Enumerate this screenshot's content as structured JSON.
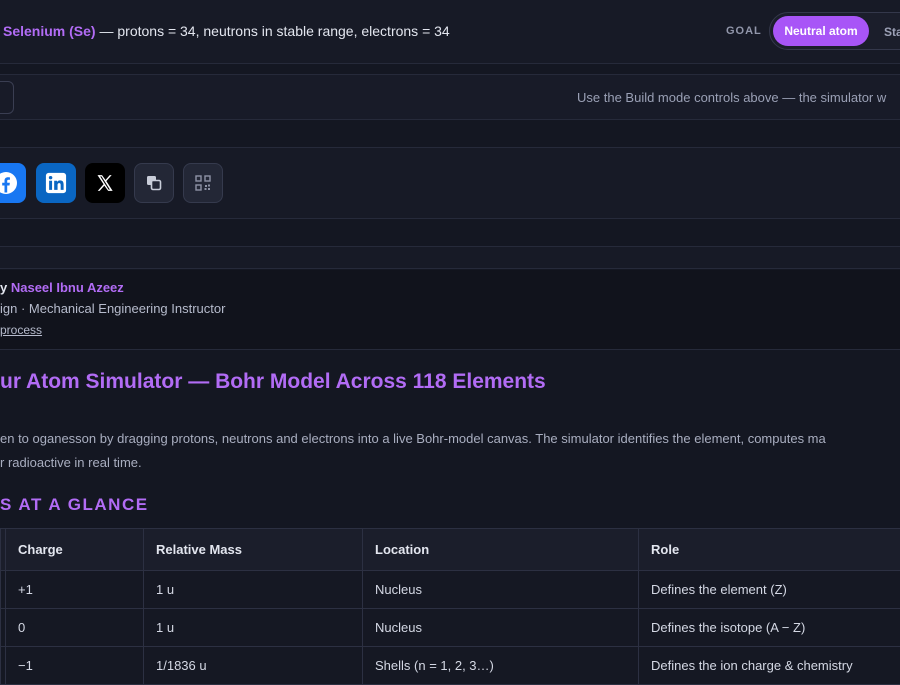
{
  "goal_bar": {
    "element": "Selenium (Se)",
    "description": " — protons = 34, neutrons in stable range, electrons = 34",
    "goal_label": "GOAL",
    "toggle_active": "Neutral atom",
    "toggle_next": "Sta"
  },
  "hint": {
    "text": "Use the Build mode controls above — the simulator w"
  },
  "share": {
    "facebook_icon": "facebook-icon",
    "linkedin_icon": "linkedin-icon",
    "x_icon": "x-icon",
    "copy_icon": "copy-icon",
    "qr_icon": "qr-code-icon"
  },
  "author": {
    "prefix": "y ",
    "name": "Naseel Ibnu Azeez",
    "role": "ign · Mechanical Engineering Instructor",
    "link": "process"
  },
  "article": {
    "title": "ur Atom Simulator — Bohr Model Across 118 Elements",
    "desc_line1": "en to oganesson by dragging protons, neutrons and electrons into a live Bohr-model canvas. The simulator identifies the element, computes ma",
    "desc_line2": "r radioactive in real time.",
    "section": "S AT A GLANCE"
  },
  "table": {
    "headers": [
      "",
      "Charge",
      "Relative Mass",
      "Location",
      "Role"
    ],
    "rows": [
      [
        "",
        "+1",
        "1 u",
        "Nucleus",
        "Defines the element (Z)"
      ],
      [
        "",
        "0",
        "1 u",
        "Nucleus",
        "Defines the isotope (A − Z)"
      ],
      [
        "",
        "−1",
        "1/1836 u",
        "Shells (n = 1, 2, 3…)",
        "Defines the ion charge & chemistry"
      ]
    ]
  },
  "colors": {
    "accent": "#a855f7",
    "background": "#141722"
  }
}
